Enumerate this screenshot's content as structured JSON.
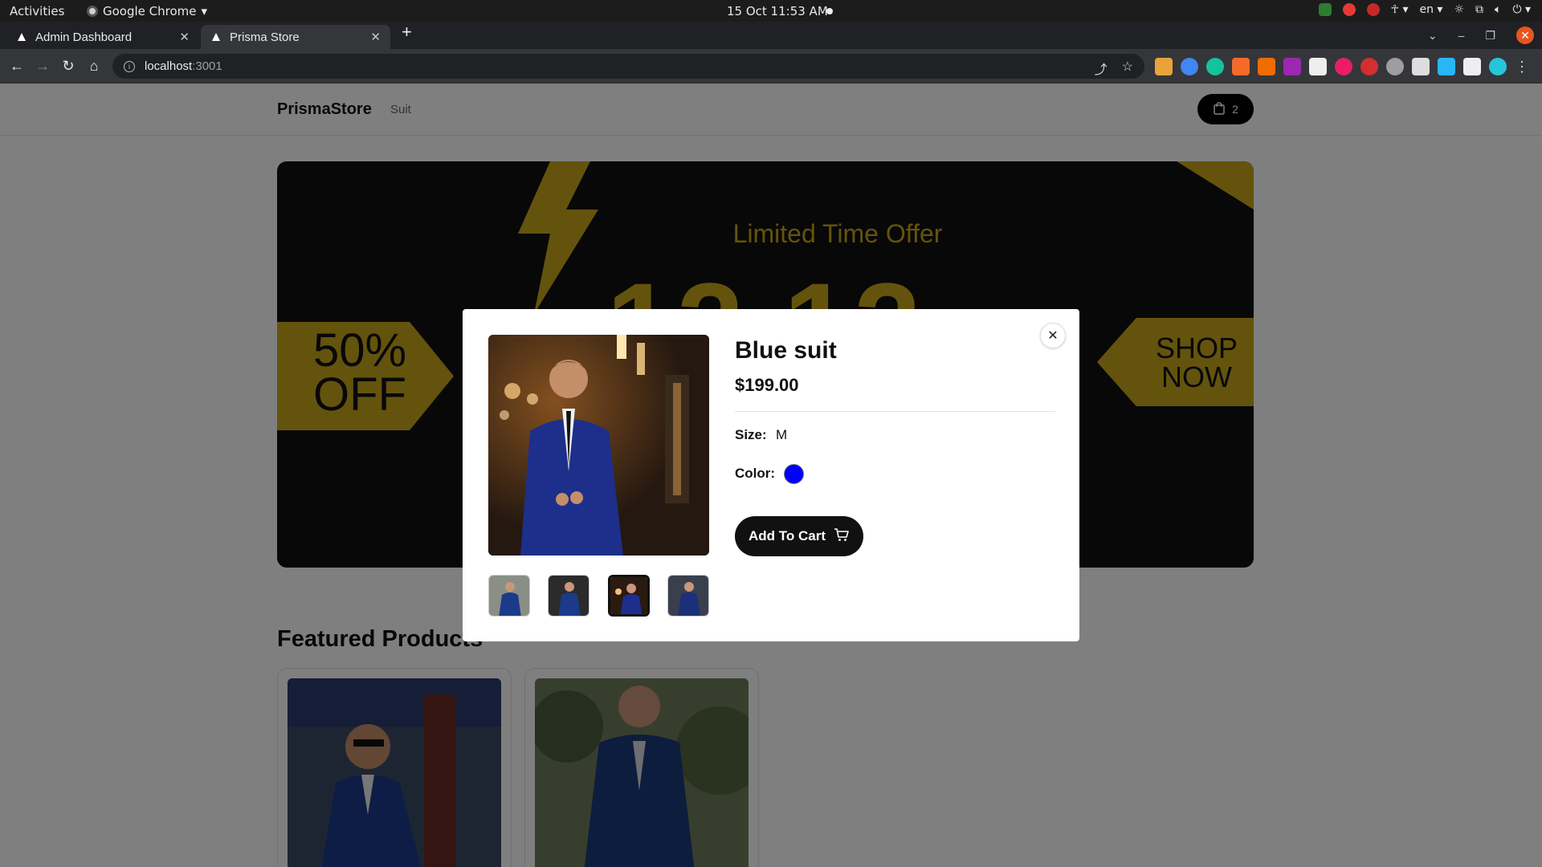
{
  "os": {
    "activities": "Activities",
    "app_name": "Google Chrome",
    "clock": "15 Oct  11:53 AM",
    "lang": "en"
  },
  "browser": {
    "tabs": [
      {
        "title": "Admin Dashboard",
        "active": false
      },
      {
        "title": "Prisma Store",
        "active": true
      }
    ],
    "url_host": "localhost",
    "url_port": ":3001"
  },
  "site": {
    "brand": "PrismaStore",
    "nav_links": [
      "Suit"
    ],
    "cart_count": "2"
  },
  "billboard": {
    "offer_text": "Limited Time Offer",
    "big_text": "12.12",
    "left_badge": "50%\nOFF",
    "right_badge": "SHOP\nNOW"
  },
  "featured": {
    "title": "Featured Products"
  },
  "modal": {
    "product_name": "Blue suit",
    "price": "$199.00",
    "size_label": "Size:",
    "size_value": "M",
    "color_label": "Color:",
    "color_hex": "#0000ff",
    "add_to_cart": "Add To Cart",
    "close_icon": "close-icon",
    "thumbnail_count": 4,
    "selected_thumbnail": 3
  },
  "colors": {
    "accent_gold": "#c9a61a",
    "primary_dark": "#111111"
  }
}
